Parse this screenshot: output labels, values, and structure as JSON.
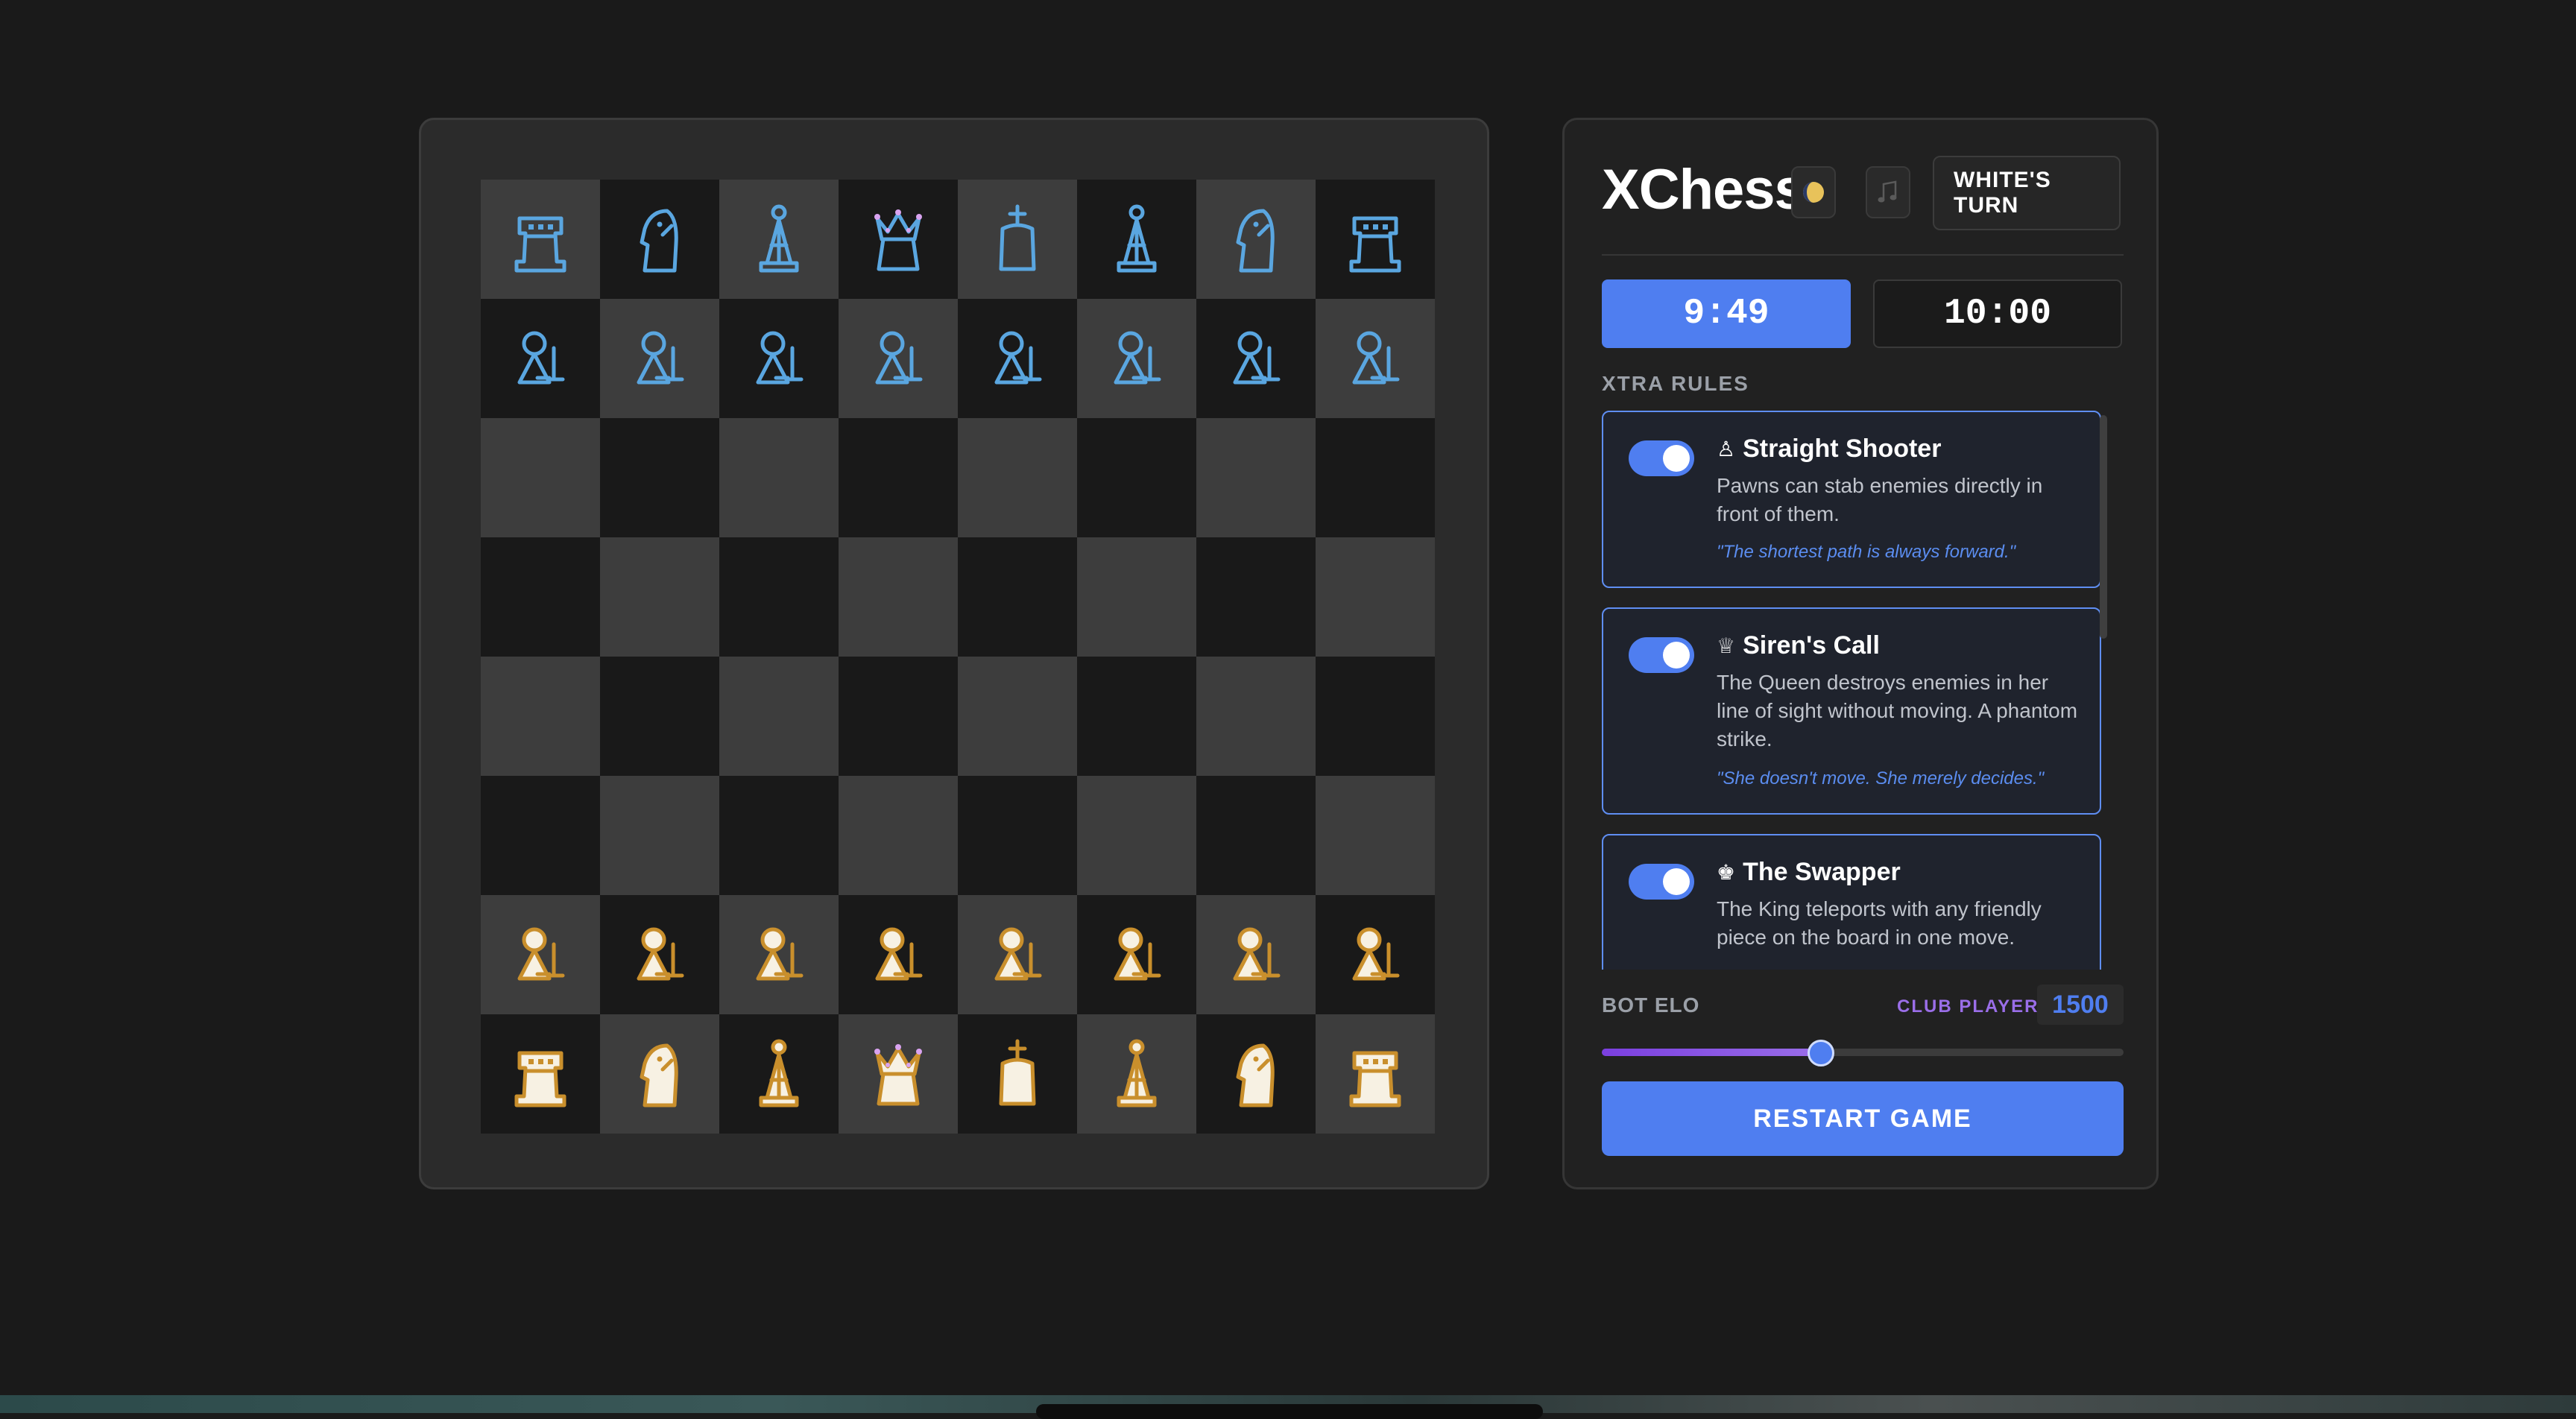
{
  "app": {
    "title": "XChess"
  },
  "header": {
    "theme_icon": "moon-theme-icon",
    "music_icon": "music-note-icon",
    "turn_label": "WHITE'S TURN"
  },
  "clocks": {
    "player": "9:49",
    "opponent": "10:00",
    "active": "player"
  },
  "rules": {
    "heading": "XTRA RULES",
    "items": [
      {
        "icon": "♙",
        "icon_name": "pawn-icon",
        "enabled": true,
        "title": "Straight Shooter",
        "description": "Pawns can stab enemies directly in front of them.",
        "quote": "\"The shortest path is always forward.\""
      },
      {
        "icon": "♕",
        "icon_name": "queen-icon",
        "enabled": true,
        "title": "Siren's Call",
        "description": "The Queen destroys enemies in her line of sight without moving. A phantom strike.",
        "quote": "\"She doesn't move. She merely decides.\""
      },
      {
        "icon": "♚",
        "icon_name": "king-icon",
        "enabled": true,
        "title": "The Swapper",
        "description": "The King teleports with any friendly piece on the board in one move.",
        "quote": ""
      }
    ]
  },
  "bot": {
    "label": "BOT ELO",
    "tier": "CLUB PLAYER",
    "elo": "1500",
    "slider_fraction": 0.42
  },
  "actions": {
    "restart_label": "RESTART GAME"
  },
  "board": {
    "rows": [
      [
        "br",
        "bn",
        "bb",
        "bq",
        "bk",
        "bb",
        "bn",
        "br"
      ],
      [
        "bp",
        "bp",
        "bp",
        "bp",
        "bp",
        "bp",
        "bp",
        "bp"
      ],
      [
        "",
        "",
        "",
        "",
        "",
        "",
        "",
        ""
      ],
      [
        "",
        "",
        "",
        "",
        "",
        "",
        "",
        ""
      ],
      [
        "",
        "",
        "",
        "",
        "",
        "",
        "",
        ""
      ],
      [
        "",
        "",
        "",
        "",
        "",
        "",
        "",
        ""
      ],
      [
        "wp",
        "wp",
        "wp",
        "wp",
        "wp",
        "wp",
        "wp",
        "wp"
      ],
      [
        "wr",
        "wn",
        "wb",
        "wq",
        "wk",
        "wb",
        "wn",
        "wr"
      ]
    ]
  },
  "colors": {
    "accent": "#4f7ef0",
    "black_piece": "#5aa6e0",
    "white_piece_fill": "#f7f1e3",
    "white_piece_outline": "#c98f2c",
    "square_light": "#3d3d3d",
    "square_dark": "#191919",
    "tier_purple": "#9a6ee8"
  }
}
